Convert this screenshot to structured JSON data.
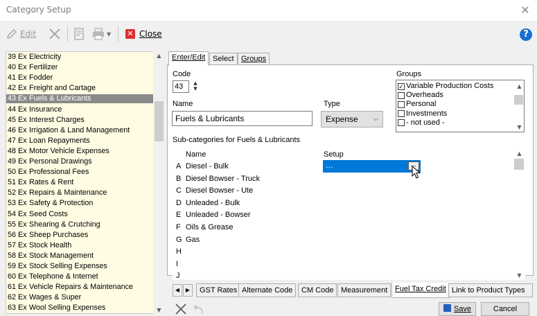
{
  "window": {
    "title": "Category Setup",
    "close_glyph": "✕"
  },
  "toolbar": {
    "edit_label": "Edit",
    "close_label": "Close",
    "help_glyph": "?"
  },
  "categories": [
    {
      "num": "39",
      "type": "Ex",
      "label": "Electricity"
    },
    {
      "num": "40",
      "type": "Ex",
      "label": "Fertilizer"
    },
    {
      "num": "41",
      "type": "Ex",
      "label": "Fodder"
    },
    {
      "num": "42",
      "type": "Ex",
      "label": "Freight and Cartage"
    },
    {
      "num": "43",
      "type": "Ex",
      "label": "Fuels & Lubricants"
    },
    {
      "num": "44",
      "type": "Ex",
      "label": "Insurance"
    },
    {
      "num": "45",
      "type": "Ex",
      "label": "Interest Charges"
    },
    {
      "num": "46",
      "type": "Ex",
      "label": "Irrigation & Land Management"
    },
    {
      "num": "47",
      "type": "Ex",
      "label": "Loan Repayments"
    },
    {
      "num": "48",
      "type": "Ex",
      "label": "Motor Vehicle Expenses"
    },
    {
      "num": "49",
      "type": "Ex",
      "label": "Personal Drawings"
    },
    {
      "num": "50",
      "type": "Ex",
      "label": "Professional Fees"
    },
    {
      "num": "51",
      "type": "Ex",
      "label": "Rates & Rent"
    },
    {
      "num": "52",
      "type": "Ex",
      "label": "Repairs & Maintenance"
    },
    {
      "num": "53",
      "type": "Ex",
      "label": "Safety & Protection"
    },
    {
      "num": "54",
      "type": "Ex",
      "label": "Seed Costs"
    },
    {
      "num": "55",
      "type": "Ex",
      "label": "Shearing & Crutching"
    },
    {
      "num": "56",
      "type": "Ex",
      "label": "Sheep Purchases"
    },
    {
      "num": "57",
      "type": "Ex",
      "label": "Stock Health"
    },
    {
      "num": "58",
      "type": "Ex",
      "label": "Stock Management"
    },
    {
      "num": "59",
      "type": "Ex",
      "label": "Stock Selling Expenses"
    },
    {
      "num": "60",
      "type": "Ex",
      "label": "Telephone & Internet"
    },
    {
      "num": "61",
      "type": "Ex",
      "label": "Vehicle Repairs & Maintenance"
    },
    {
      "num": "62",
      "type": "Ex",
      "label": "Wages & Super"
    },
    {
      "num": "63",
      "type": "Ex",
      "label": "Wool Selling Expenses"
    }
  ],
  "selected_category_index": 4,
  "tabs": [
    "Enter/Edit",
    "Select",
    "Groups"
  ],
  "form": {
    "code_label": "Code",
    "code_value": "43",
    "name_label": "Name",
    "name_value": "Fuels & Lubricants",
    "type_label": "Type",
    "type_value": "Expense",
    "groups_label": "Groups",
    "groups": [
      {
        "label": "Variable Production Costs",
        "checked": true
      },
      {
        "label": "Overheads",
        "checked": false
      },
      {
        "label": "Personal",
        "checked": false
      },
      {
        "label": "Investments",
        "checked": false
      },
      {
        "label": "- not used -",
        "checked": false
      }
    ],
    "subcats_label": "Sub-categories for Fuels & Lubricants"
  },
  "subgrid": {
    "col_name": "Name",
    "col_setup": "Setup",
    "setup_value": "...",
    "setup_btn": "...",
    "rows": [
      {
        "letter": "A",
        "name": "Diesel - Bulk"
      },
      {
        "letter": "B",
        "name": "Diesel Bowser - Truck"
      },
      {
        "letter": "C",
        "name": "Diesel Bowser - Ute"
      },
      {
        "letter": "D",
        "name": "Unleaded - Bulk"
      },
      {
        "letter": "E",
        "name": "Unleaded - Bowser"
      },
      {
        "letter": "F",
        "name": "Oils & Grease"
      },
      {
        "letter": "G",
        "name": "Gas"
      },
      {
        "letter": "H",
        "name": ""
      },
      {
        "letter": "I",
        "name": ""
      },
      {
        "letter": "J",
        "name": ""
      }
    ]
  },
  "bottom_tabs": {
    "gst": "GST Rates",
    "alternate": "Alternate Code",
    "cm": "CM Code",
    "measurement": "Measurement",
    "fuel": "Fuel Tax Credit",
    "link": "Link to Product Types"
  },
  "buttons": {
    "save": "Save",
    "cancel": "Cancel"
  },
  "colors": {
    "selected_row": "#8a8a8a",
    "list_bg": "#fffce3",
    "highlight": "#0078d7",
    "save_icon": "#1f5fbf"
  }
}
